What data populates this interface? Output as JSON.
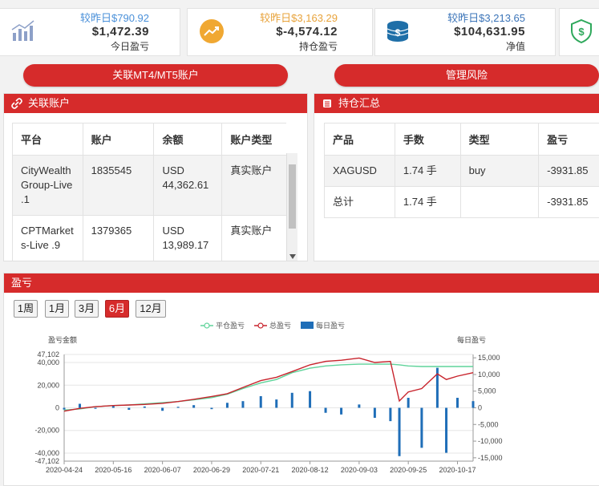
{
  "stats": {
    "today": {
      "prev": "较昨日$790.92",
      "value": "$1,472.39",
      "label": "今日盈亏",
      "icon": "bar-chart-icon"
    },
    "position": {
      "prev": "较昨日$3,163.29",
      "value": "$-4,574.12",
      "label": "持仓盈亏",
      "icon": "trend-up-icon"
    },
    "equity": {
      "prev": "较昨日$3,213.65",
      "value": "$104,631.95",
      "label": "净值",
      "icon": "dollar-coins-icon"
    },
    "risk": {
      "icon": "shield-dollar-icon"
    }
  },
  "buttons": {
    "link_accounts": "关联MT4/MT5账户",
    "manage_risk": "管理风险"
  },
  "accounts_panel": {
    "title": "关联账户",
    "headers": [
      "平台",
      "账户",
      "余额",
      "账户类型"
    ],
    "rows": [
      {
        "platform": "CityWealthGroup-Live .1",
        "account": "1835545",
        "balance": "USD 44,362.61",
        "type": "真实账户"
      },
      {
        "platform": "CPTMarkets-Live .9",
        "account": "1379365",
        "balance": "USD 13,989.17",
        "type": "真实账户"
      }
    ]
  },
  "positions_panel": {
    "title": "持仓汇总",
    "headers": [
      "产品",
      "手数",
      "类型",
      "盈亏"
    ],
    "rows": [
      {
        "product": "XAGUSD",
        "lots": "1.74 手",
        "type": "buy",
        "pnl": "-3931.85"
      },
      {
        "product": "总计",
        "lots": "1.74 手",
        "type": "",
        "pnl": "-3931.85"
      }
    ]
  },
  "pnl_panel": {
    "title": "盈亏",
    "periods": [
      "1周",
      "1月",
      "3月",
      "6月",
      "12月"
    ],
    "active_period": "6月"
  },
  "chart_data": {
    "type": "line",
    "left_axis_title": "盈亏金额",
    "right_axis_title": "每日盈亏",
    "legend": [
      "平仓盈亏",
      "总盈亏",
      "每日盈亏"
    ],
    "colors": {
      "closed": "#5fd39a",
      "total": "#c8232c",
      "daily": "#1f6eb8"
    },
    "left_ticks": [
      "47,102",
      "40,000",
      "20,000",
      "0",
      "-20,000",
      "-40,000",
      "-47,102"
    ],
    "left_tick_values": [
      47102,
      40000,
      20000,
      0,
      -20000,
      -40000,
      -47102
    ],
    "left_ylim": [
      -47102,
      47102
    ],
    "right_ticks": [
      "15,000",
      "10,000",
      "5,000",
      "0",
      "-5,000",
      "-10,000",
      "-15,000"
    ],
    "right_tick_values": [
      15000,
      10000,
      5000,
      0,
      -5000,
      -10000,
      -15000
    ],
    "right_ylim": [
      -16000,
      16000
    ],
    "x_ticks": [
      "2020-04-24",
      "2020-05-16",
      "2020-06-07",
      "2020-06-29",
      "2020-07-21",
      "2020-08-12",
      "2020-09-03",
      "2020-09-25",
      "2020-10-17"
    ],
    "x": [
      "2020-04-24",
      "2020-05-01",
      "2020-05-08",
      "2020-05-16",
      "2020-05-23",
      "2020-05-30",
      "2020-06-07",
      "2020-06-14",
      "2020-06-21",
      "2020-06-29",
      "2020-07-06",
      "2020-07-13",
      "2020-07-21",
      "2020-07-28",
      "2020-08-04",
      "2020-08-12",
      "2020-08-19",
      "2020-08-26",
      "2020-09-03",
      "2020-09-10",
      "2020-09-17",
      "2020-09-21",
      "2020-09-25",
      "2020-10-01",
      "2020-10-08",
      "2020-10-12",
      "2020-10-17",
      "2020-10-24"
    ],
    "series": [
      {
        "name": "平仓盈亏",
        "values": [
          -2000,
          -1000,
          1000,
          2000,
          2500,
          3500,
          4500,
          5500,
          7000,
          9000,
          12000,
          17000,
          22000,
          25000,
          31000,
          35000,
          37000,
          38000,
          38500,
          38500,
          38500,
          38000,
          37000,
          36500,
          36500,
          36500,
          36500,
          36500
        ]
      },
      {
        "name": "总盈亏",
        "values": [
          -3000,
          -500,
          1000,
          2000,
          2500,
          3000,
          4000,
          5500,
          7500,
          10000,
          12500,
          18000,
          24000,
          27000,
          32000,
          38000,
          41000,
          42000,
          44000,
          40000,
          41000,
          6000,
          14000,
          17000,
          30000,
          25000,
          28000,
          31000
        ]
      },
      {
        "name": "每日盈亏",
        "values": [
          -500,
          1200,
          -300,
          700,
          -600,
          400,
          -900,
          300,
          800,
          -400,
          1500,
          2000,
          3500,
          2500,
          4500,
          5000,
          -1500,
          -2000,
          1000,
          -3000,
          -4000,
          -14500,
          3000,
          -12000,
          12000,
          -13500,
          3000,
          2000
        ]
      }
    ]
  }
}
